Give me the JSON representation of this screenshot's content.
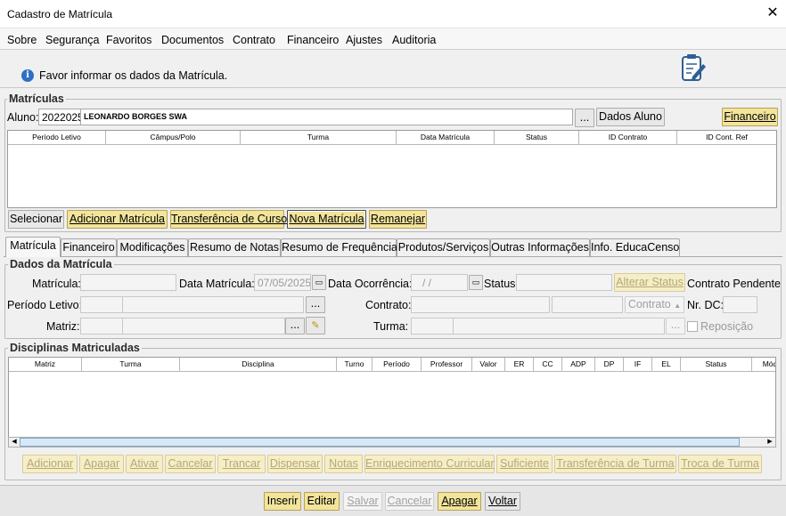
{
  "window": {
    "title": "Cadastro de Matrícula",
    "close": "✕"
  },
  "menu": [
    "Sobre",
    "Segurança",
    "Favoritos",
    "Documentos",
    "Contrato",
    "Financeiro",
    "Ajustes",
    "Auditoria"
  ],
  "info": {
    "icon": "info-icon",
    "text": "Favor informar os dados da Matrícula."
  },
  "matriculas": {
    "title": "Matrículas",
    "aluno_label": "Aluno:",
    "aluno_code": "2022025",
    "aluno_name": "LEONARDO BORGES SWA",
    "ellipsis": "...",
    "dados_aluno": "Dados Aluno",
    "financeiro": "Financeiro",
    "columns": [
      "Período Letivo",
      "Câmpus/Polo",
      "Turma",
      "Data Matrícula",
      "Status",
      "ID Contrato",
      "ID Cont. Ref"
    ],
    "buttons": [
      "Selecionar",
      "Adicionar Matrícula",
      "Transferência de Curso",
      "Nova Matrícula",
      "Remanejar"
    ]
  },
  "tabs": [
    "Matrícula",
    "Financeiro",
    "Modificações",
    "Resumo de Notas",
    "Resumo de Frequência",
    "Produtos/Serviços",
    "Outras Informações",
    "Info. EducaCenso"
  ],
  "dados": {
    "title": "Dados da Matrícula",
    "matricula_label": "Matrícula:",
    "data_matricula_label": "Data Matrícula:",
    "data_matricula_value": "07/05/2025",
    "data_ocorrencia_label": "Data Ocorrência:",
    "data_ocorrencia_value": "/  /",
    "status_label": "Status:",
    "alterar_status": "Alterar Status",
    "contrato_pendente": "Contrato Pendente",
    "periodo_label": "Período Letivo:",
    "contrato_label": "Contrato:",
    "contrato_btn": "Contrato",
    "nr_dc_label": "Nr. DC:",
    "matriz_label": "Matriz:",
    "turma_label": "Turma:",
    "reposicao": "Reposição"
  },
  "disciplinas": {
    "title": "Disciplinas Matriculadas",
    "columns": [
      "Matriz",
      "Turma",
      "Disciplina",
      "Turno",
      "Período",
      "Professor",
      "Valor",
      "ER",
      "CC",
      "ADP",
      "DP",
      "IF",
      "EL",
      "Status",
      "Mód"
    ],
    "buttons": [
      "Adicionar",
      "Apagar",
      "Ativar",
      "Cancelar",
      "Trancar",
      "Dispensar",
      "Notas",
      "Enriquecimento Curricular",
      "Suficiente",
      "Transferência de Turma",
      "Troca de Turma"
    ]
  },
  "footer": {
    "buttons": [
      "Inserir",
      "Editar",
      "Salvar",
      "Cancelar",
      "Apagar",
      "Voltar"
    ]
  }
}
